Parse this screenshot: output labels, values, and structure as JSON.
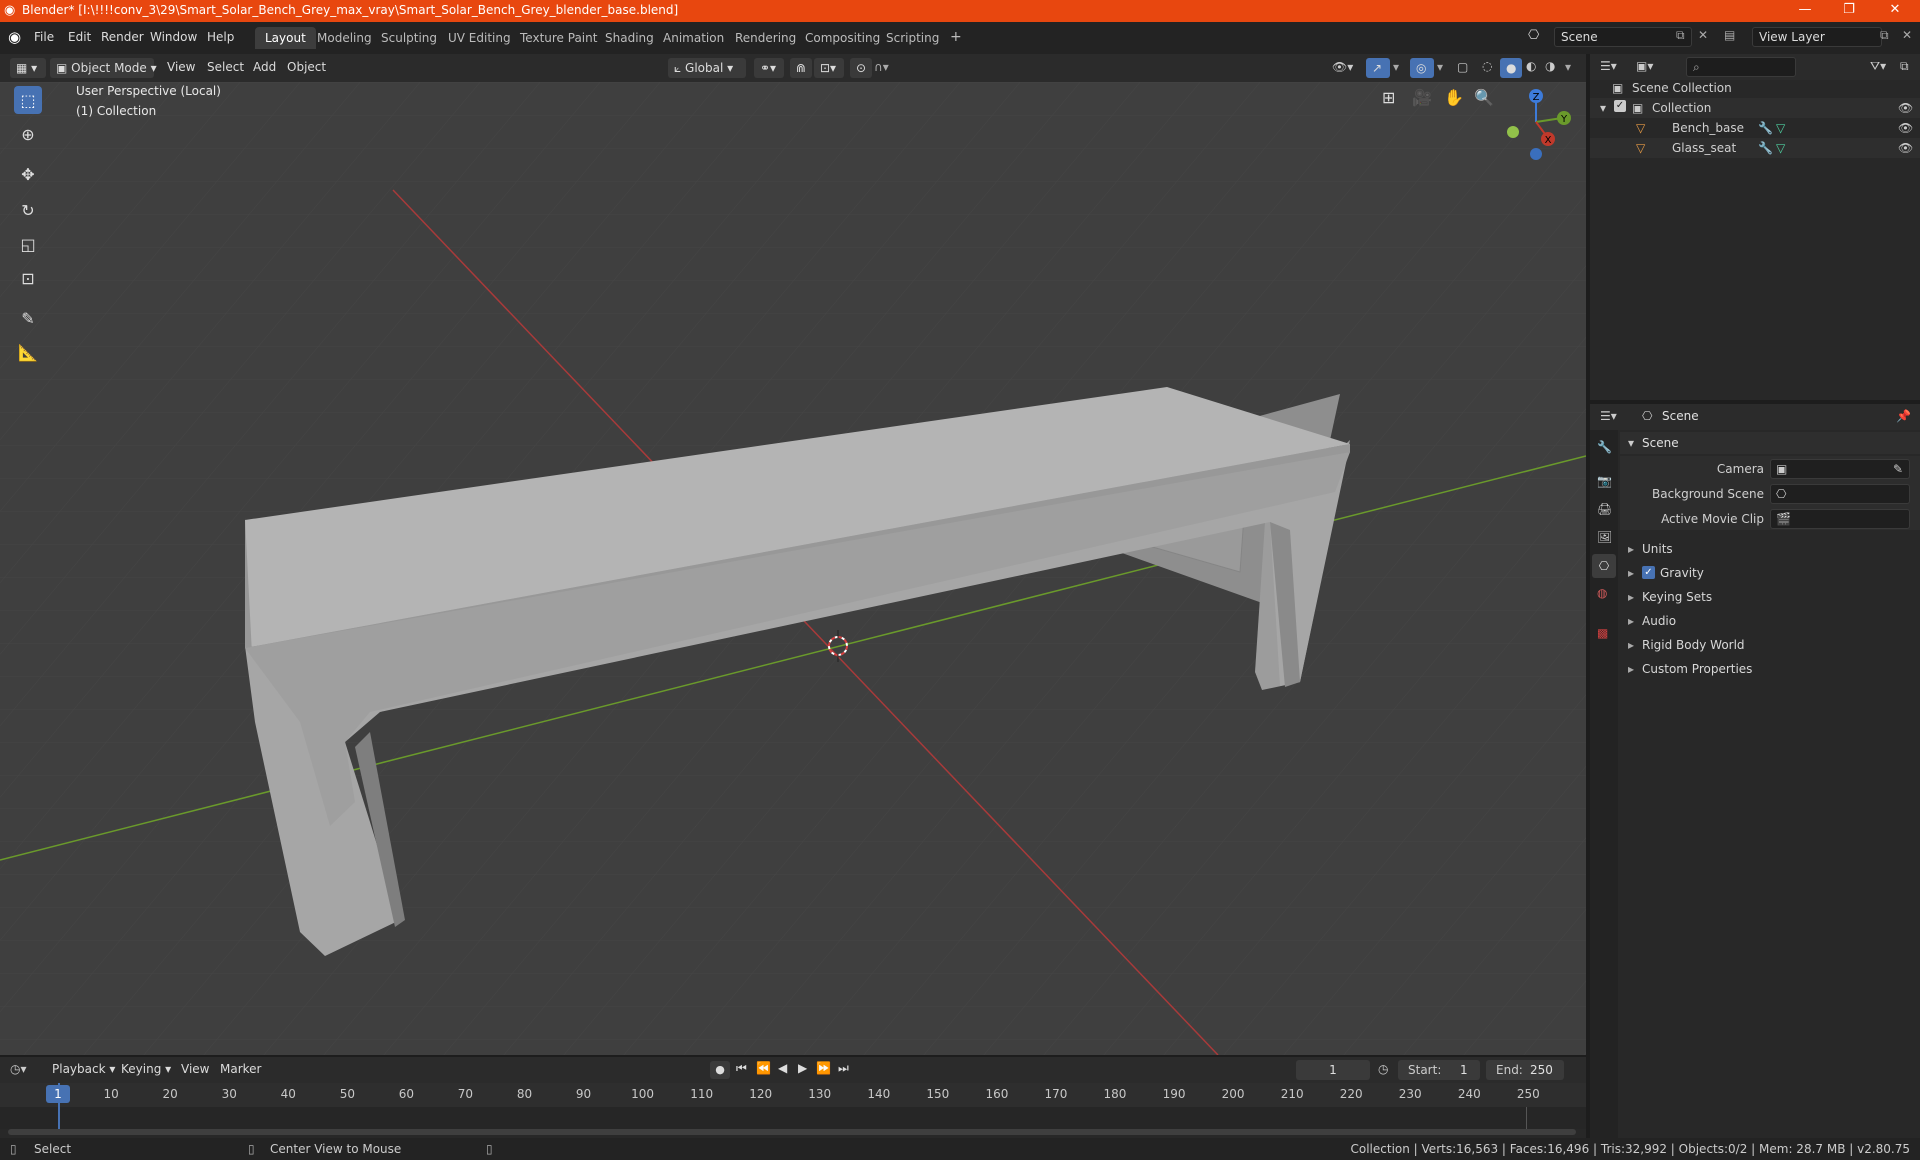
{
  "window": {
    "title": "Blender* [I:\\!!!!conv_3\\29\\Smart_Solar_Bench_Grey_max_vray\\Smart_Solar_Bench_Grey_blender_base.blend]",
    "minimize": "—",
    "maximize": "❐",
    "close": "✕"
  },
  "menus": [
    "File",
    "Edit",
    "Render",
    "Window",
    "Help"
  ],
  "workspaces": [
    "Layout",
    "Modeling",
    "Sculpting",
    "UV Editing",
    "Texture Paint",
    "Shading",
    "Animation",
    "Rendering",
    "Compositing",
    "Scripting"
  ],
  "active_workspace": "Layout",
  "add_workspace": "+",
  "scene_field": "Scene",
  "view_layer_field": "View Layer",
  "viewport_header": {
    "mode": "Object Mode",
    "menus": [
      "View",
      "Select",
      "Add",
      "Object"
    ],
    "orientation": "Global"
  },
  "viewport": {
    "perspective_label": "User Perspective (Local)",
    "collection_label": "(1) Collection",
    "gizmo": {
      "z": "Z",
      "y": "Y",
      "x": "X"
    }
  },
  "outliner": {
    "root": "Scene Collection",
    "collection": "Collection",
    "objects": [
      "Bench_base",
      "Glass_seat"
    ]
  },
  "properties": {
    "context": "Scene",
    "panel": "Scene",
    "fields": [
      {
        "label": "Camera"
      },
      {
        "label": "Background Scene"
      },
      {
        "label": "Active Movie Clip"
      }
    ],
    "subpanels": [
      "Units",
      "Gravity",
      "Keying Sets",
      "Audio",
      "Rigid Body World",
      "Custom Properties"
    ],
    "gravity_checked": true
  },
  "timeline": {
    "menus": [
      "Playback",
      "Keying",
      "View",
      "Marker"
    ],
    "current_frame": "1",
    "start_label": "Start:",
    "start": "1",
    "end_label": "End:",
    "end": "250",
    "ticks": [
      "1",
      "10",
      "20",
      "30",
      "40",
      "50",
      "60",
      "70",
      "80",
      "90",
      "100",
      "110",
      "120",
      "130",
      "140",
      "150",
      "160",
      "170",
      "180",
      "190",
      "200",
      "210",
      "220",
      "230",
      "240",
      "250"
    ]
  },
  "status": {
    "select": "Select",
    "center": "Center View to Mouse",
    "stats": "Collection | Verts:16,563 | Faces:16,496 | Tris:32,992 | Objects:0/2 | Mem: 28.7 MB | v2.80.75"
  },
  "colors": {
    "title_bar": "#e8470f",
    "accent": "#4772b3",
    "x_axis": "#c0392b",
    "y_axis": "#6a9a2b",
    "z_axis": "#3d7bd9"
  }
}
